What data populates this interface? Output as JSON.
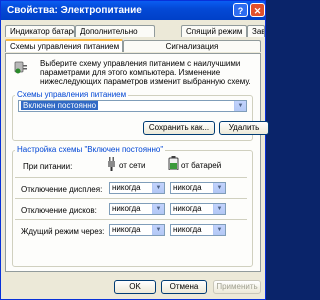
{
  "window": {
    "title": "Свойства: Электропитание",
    "help_label": "?",
    "close_label": "✕"
  },
  "tabs": {
    "row_back": [
      "Индикатор батарей",
      "Дополнительно",
      "Спящий режим",
      "Завко"
    ],
    "row_front": [
      "Схемы управления питанием",
      "Сигнализация"
    ],
    "active": "Схемы управления питанием"
  },
  "description": "Выберите схему управления питанием с наилучшими параметрами для этого компьютера. Изменение нижеследующих параметров изменит выбранную схему.",
  "schemes": {
    "group_label": "Схемы управления питанием",
    "selected": "Включен постоянно",
    "save_as_label": "Сохранить как...",
    "delete_label": "Удалить"
  },
  "settings": {
    "group_label": "Настройка схемы \"Включен постоянно\"",
    "power_source_label": "При питании:",
    "ac_label": "от сети",
    "battery_label": "от батарей",
    "rows": [
      {
        "label": "Отключение дисплея:",
        "ac": "никогда",
        "battery": "никогда"
      },
      {
        "label": "Отключение дисков:",
        "ac": "никогда",
        "battery": "никогда"
      },
      {
        "label": "Ждущий режим через:",
        "ac": "никогда",
        "battery": "никогда"
      }
    ]
  },
  "buttons": {
    "ok": "OK",
    "cancel": "Отмена",
    "apply": "Применить"
  }
}
